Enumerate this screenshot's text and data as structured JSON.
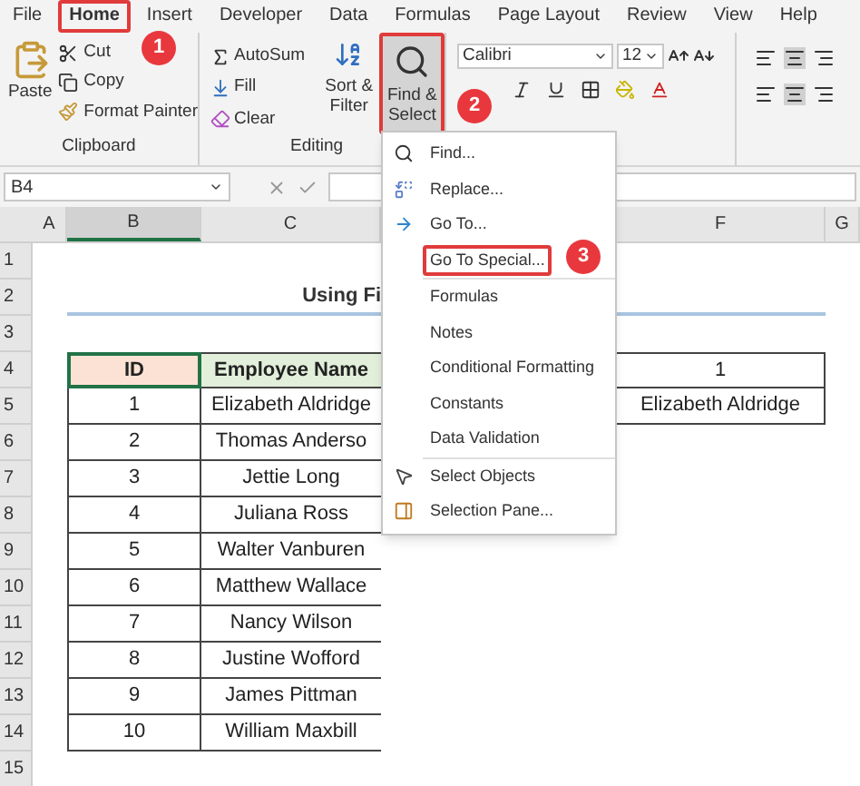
{
  "menu_tabs": [
    {
      "label": "File",
      "selected": false
    },
    {
      "label": "Home",
      "selected": true
    },
    {
      "label": "Insert",
      "selected": false
    },
    {
      "label": "Developer",
      "selected": false
    },
    {
      "label": "Data",
      "selected": false
    },
    {
      "label": "Formulas",
      "selected": false
    },
    {
      "label": "Page Layout",
      "selected": false
    },
    {
      "label": "Review",
      "selected": false
    },
    {
      "label": "View",
      "selected": false
    },
    {
      "label": "Help",
      "selected": false
    }
  ],
  "ribbon": {
    "clipboard": {
      "paste": "Paste",
      "cut": "Cut",
      "copy": "Copy",
      "format_painter": "Format Painter",
      "label": "Clipboard"
    },
    "editing": {
      "autosum": "AutoSum",
      "fill": "Fill",
      "clear": "Clear",
      "sort_lines": [
        "Sort &",
        "Filter"
      ],
      "find_lines": [
        "Find &",
        "Select"
      ],
      "find_highlighted": true,
      "label": "Editing"
    },
    "font": {
      "name": "Calibri",
      "size": "12"
    }
  },
  "callouts": [
    "1",
    "2",
    "3"
  ],
  "formula_bar": {
    "name_box": "B4"
  },
  "columns": [
    {
      "label": "A",
      "selected": false
    },
    {
      "label": "B",
      "selected": true
    },
    {
      "label": "C",
      "selected": false
    },
    {
      "label": "F",
      "selected": false
    },
    {
      "label": "G",
      "selected": false
    }
  ],
  "row_numbers": [
    "1",
    "2",
    "3",
    "4",
    "5",
    "6",
    "7",
    "8",
    "9",
    "10",
    "11",
    "12",
    "13",
    "14",
    "15"
  ],
  "sheet": {
    "title": "Using Fi",
    "headers": [
      "ID",
      "Employee Name"
    ],
    "rows": [
      [
        "1",
        "Elizabeth Aldridge"
      ],
      [
        "2",
        "Thomas Anderso"
      ],
      [
        "3",
        "Jettie Long"
      ],
      [
        "4",
        "Juliana Ross"
      ],
      [
        "5",
        "Walter Vanburen"
      ],
      [
        "6",
        "Matthew Wallace"
      ],
      [
        "7",
        "Nancy Wilson"
      ],
      [
        "8",
        "Justine Wofford"
      ],
      [
        "9",
        "James Pittman"
      ],
      [
        "10",
        "William Maxbill"
      ]
    ],
    "result": [
      "1",
      "Elizabeth Aldridge"
    ]
  },
  "dropdown": {
    "groups": [
      [
        {
          "label": "Find...",
          "kind": "find",
          "highlighted": false
        },
        {
          "label": "Replace...",
          "kind": "replace",
          "highlighted": false
        },
        {
          "label": "Go To...",
          "kind": "goto",
          "highlighted": false
        },
        {
          "label": "Go To Special...",
          "kind": "plain",
          "highlighted": true
        }
      ],
      [
        {
          "label": "Formulas",
          "kind": "plain",
          "highlighted": false
        },
        {
          "label": "Notes",
          "kind": "plain",
          "highlighted": false
        },
        {
          "label": "Conditional Formatting",
          "kind": "plain",
          "highlighted": false
        },
        {
          "label": "Constants",
          "kind": "plain",
          "highlighted": false
        },
        {
          "label": "Data Validation",
          "kind": "plain",
          "highlighted": false
        }
      ],
      [
        {
          "label": "Select Objects",
          "kind": "select",
          "highlighted": false
        },
        {
          "label": "Selection Pane...",
          "kind": "pane",
          "highlighted": false
        }
      ]
    ]
  }
}
